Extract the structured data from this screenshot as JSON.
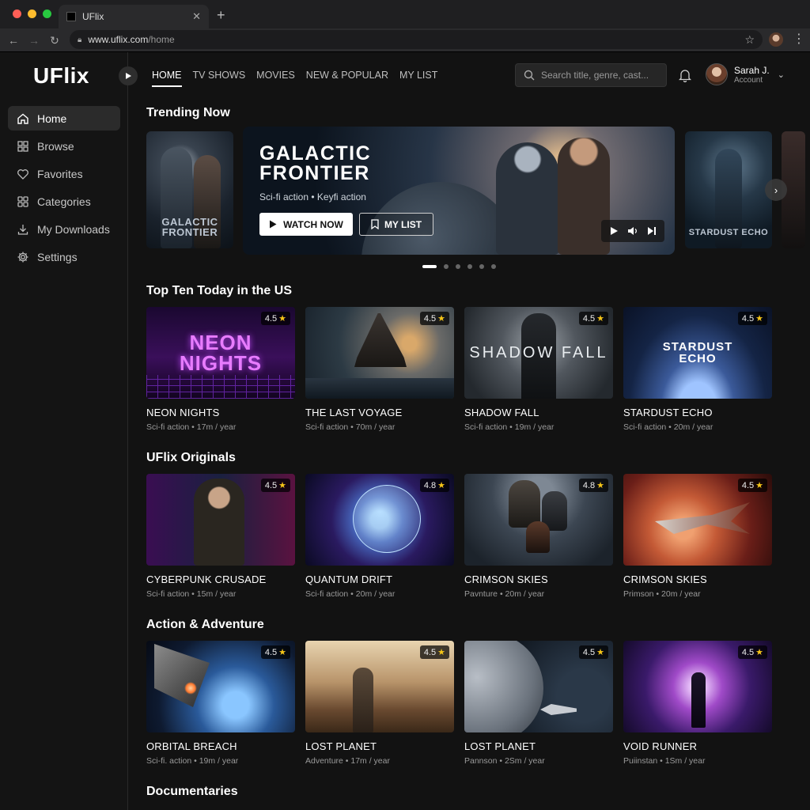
{
  "browser": {
    "tab_title": "UFlix",
    "url_domain": "www.uflix.com",
    "url_path": "/home"
  },
  "brand": {
    "logo": "UFlix"
  },
  "sidebar": {
    "items": [
      {
        "label": "Home",
        "icon": "home-icon"
      },
      {
        "label": "Browse",
        "icon": "grid-icon"
      },
      {
        "label": "Favorites",
        "icon": "heart-icon"
      },
      {
        "label": "Categories",
        "icon": "grid-icon"
      },
      {
        "label": "My Downloads",
        "icon": "download-icon"
      },
      {
        "label": "Settings",
        "icon": "gear-icon"
      }
    ]
  },
  "topnav": {
    "tabs": [
      "HOME",
      "TV SHOWS",
      "MOVIES",
      "NEW & POPULAR",
      "MY LIST"
    ],
    "search_placeholder": "Search title, genre, cast...",
    "user_name": "Sarah J.",
    "user_sub": "Account"
  },
  "trending": {
    "title": "Trending Now",
    "left_card_caption": "GALACTIC FRONTIER",
    "right_card_caption": "STARDUST ECHO",
    "hero_title_line1": "GALACTIC",
    "hero_title_line2": "FRONTIER",
    "hero_subtitle": "Sci-fi action • Keyfi action",
    "watch_label": "WATCH NOW",
    "list_label": "MY LIST"
  },
  "sections": [
    {
      "title": "Top Ten Today in the US",
      "cards": [
        {
          "title": "NEON NIGHTS",
          "meta": "Sci-fi  action • 17m / year",
          "rating": "4.5",
          "thumb_text": "NEON NIGHTS"
        },
        {
          "title": "THE LAST VOYAGE",
          "meta": "Sci-fi action • 70m / year",
          "rating": "4.5",
          "thumb_text": ""
        },
        {
          "title": "SHADOW FALL",
          "meta": "Sci-fi action • 19m / year",
          "rating": "4.5",
          "thumb_text": "SHADOW FALL"
        },
        {
          "title": "STARDUST ECHO",
          "meta": "Sci-fi action • 20m / year",
          "rating": "4.5",
          "thumb_text": "STARDUST ECHO"
        }
      ]
    },
    {
      "title": "UFlix Originals",
      "cards": [
        {
          "title": "CYBERPUNK CRUSADE",
          "meta": "Sci-fi  action • 15m / year",
          "rating": "4.5",
          "thumb_text": ""
        },
        {
          "title": "QUANTUM DRIFT",
          "meta": "Sci-fi action • 20m / year",
          "rating": "4.8",
          "thumb_text": ""
        },
        {
          "title": "CRIMSON SKIES",
          "meta": "Pavnture • 20m / year",
          "rating": "4.8",
          "thumb_text": ""
        },
        {
          "title": "CRIMSON SKIES",
          "meta": "Primson • 20m / year",
          "rating": "4.5",
          "thumb_text": ""
        }
      ]
    },
    {
      "title": "Action & Adventure",
      "cards": [
        {
          "title": "ORBITAL BREACH",
          "meta": "Sci-fi. action • 19m / year",
          "rating": "4.5",
          "thumb_text": ""
        },
        {
          "title": "LOST PLANET",
          "meta": "Adventure • 17m / year",
          "rating": "4.5",
          "thumb_text": ""
        },
        {
          "title": "LOST PLANET",
          "meta": "Pannson • 2Sm / year",
          "rating": "4.5",
          "thumb_text": ""
        },
        {
          "title": "VOID RUNNER",
          "meta": "Puiinstan • 1Sm / year",
          "rating": "4.5",
          "thumb_text": ""
        }
      ]
    }
  ],
  "next_section_title": "Documentaries",
  "colors": {
    "accent": "#ffffff",
    "background": "#121212",
    "star": "#f5c518"
  }
}
